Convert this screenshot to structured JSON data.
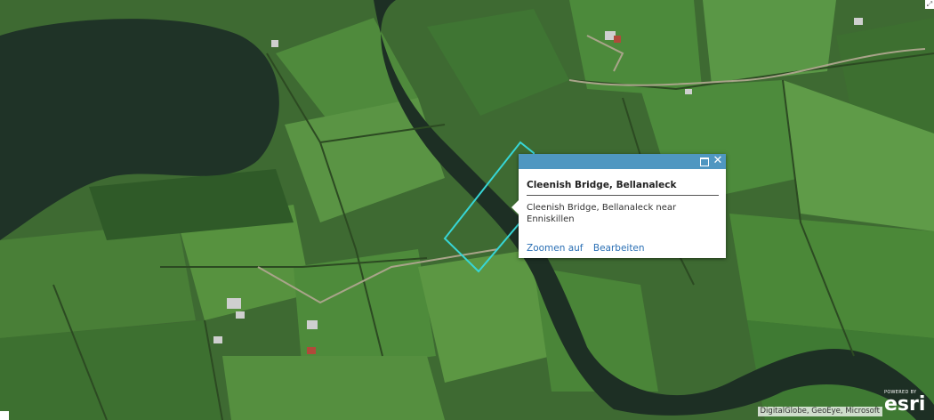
{
  "map": {
    "water_color": "#1f3327",
    "highlight_color": "#37d6d6"
  },
  "popup": {
    "title": "Cleenish Bridge, Bellanaleck",
    "description": "Cleenish Bridge, Bellanaleck near Enniskillen",
    "actions": {
      "zoom_label": "Zoomen auf",
      "edit_label": "Bearbeiten"
    },
    "header_color": "#4f97c1",
    "close_glyph": "✕"
  },
  "attribution": "DigitalGlobe, GeoEye, Microsoft",
  "esri_logo": {
    "powered": "POWERED BY",
    "brand": "esri"
  }
}
